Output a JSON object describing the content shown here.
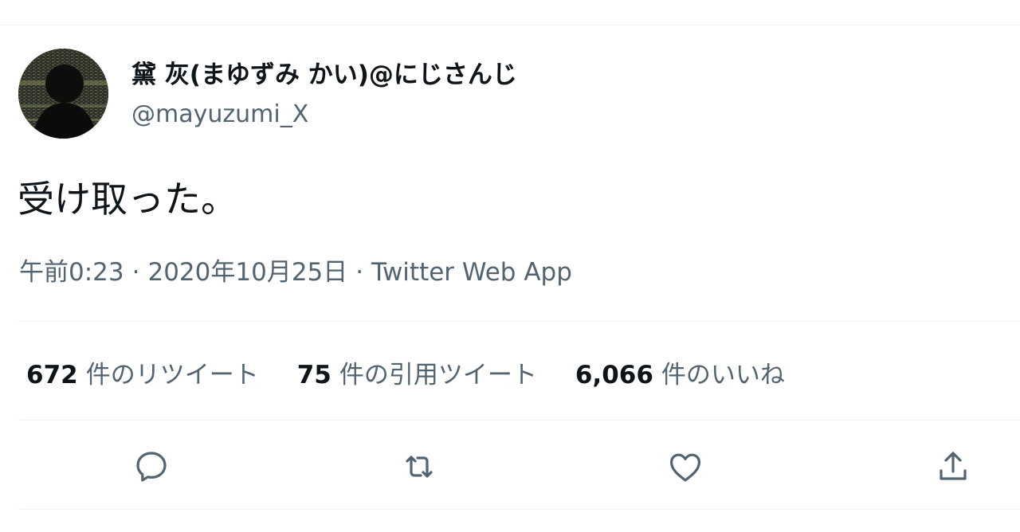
{
  "author": {
    "name": "黛 灰(まゆずみ かい)@にじさんじ",
    "handle": "@mayuzumi_X",
    "avatar_icon": "user-avatar"
  },
  "tweet": {
    "text": "受け取った。",
    "time": "午前0:23",
    "date": "2020年10月25日",
    "source": "Twitter Web App",
    "separator": "·"
  },
  "stats": {
    "retweets": {
      "count": "672",
      "label": "件のリツイート"
    },
    "quotes": {
      "count": "75",
      "label": "件の引用ツイート"
    },
    "likes": {
      "count": "6,066",
      "label": "件のいいね"
    }
  },
  "actions": [
    {
      "icon": "reply-icon"
    },
    {
      "icon": "retweet-icon"
    },
    {
      "icon": "like-icon"
    },
    {
      "icon": "share-icon"
    }
  ],
  "colors": {
    "primary_text": "#0f1419",
    "secondary_text": "#536471",
    "divider": "#eff3f4"
  }
}
